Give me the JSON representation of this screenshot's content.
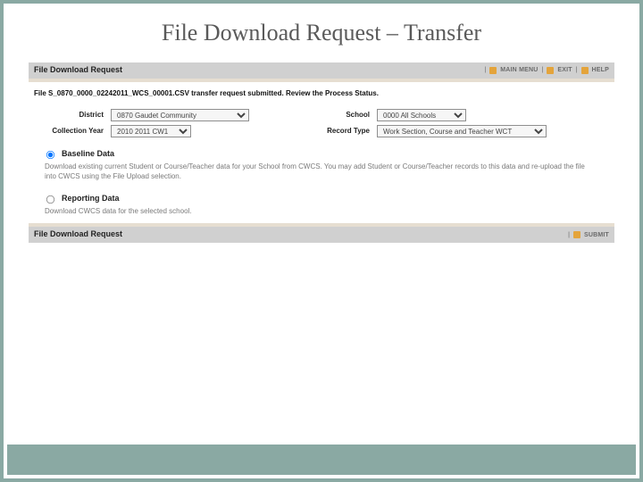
{
  "slide": {
    "title": "File Download Request – Transfer"
  },
  "top_band": {
    "title": "File Download Request",
    "links": {
      "main": "MAIN MENU",
      "exit": "EXIT",
      "help": "HELP"
    }
  },
  "status_message": "File S_0870_0000_02242011_WCS_00001.CSV transfer request submitted. Review the Process Status.",
  "form": {
    "district": {
      "label": "District",
      "value": "0870 Gaudet Community"
    },
    "school": {
      "label": "School",
      "value": "0000 All Schools"
    },
    "collection_year": {
      "label": "Collection Year",
      "value": "2010 2011 CW1"
    },
    "record_type": {
      "label": "Record Type",
      "value": "Work Section, Course and Teacher WCT"
    }
  },
  "sections": {
    "baseline": {
      "label": "Baseline Data",
      "desc": "Download existing current Student or Course/Teacher data for your School from CWCS. You may add Student or Course/Teacher records to this data and re-upload the file into CWCS using the File Upload selection."
    },
    "reporting": {
      "label": "Reporting Data",
      "desc": "Download CWCS data for the selected school."
    }
  },
  "bottom_band": {
    "title": "File Download Request",
    "submit": "SUBMIT"
  }
}
